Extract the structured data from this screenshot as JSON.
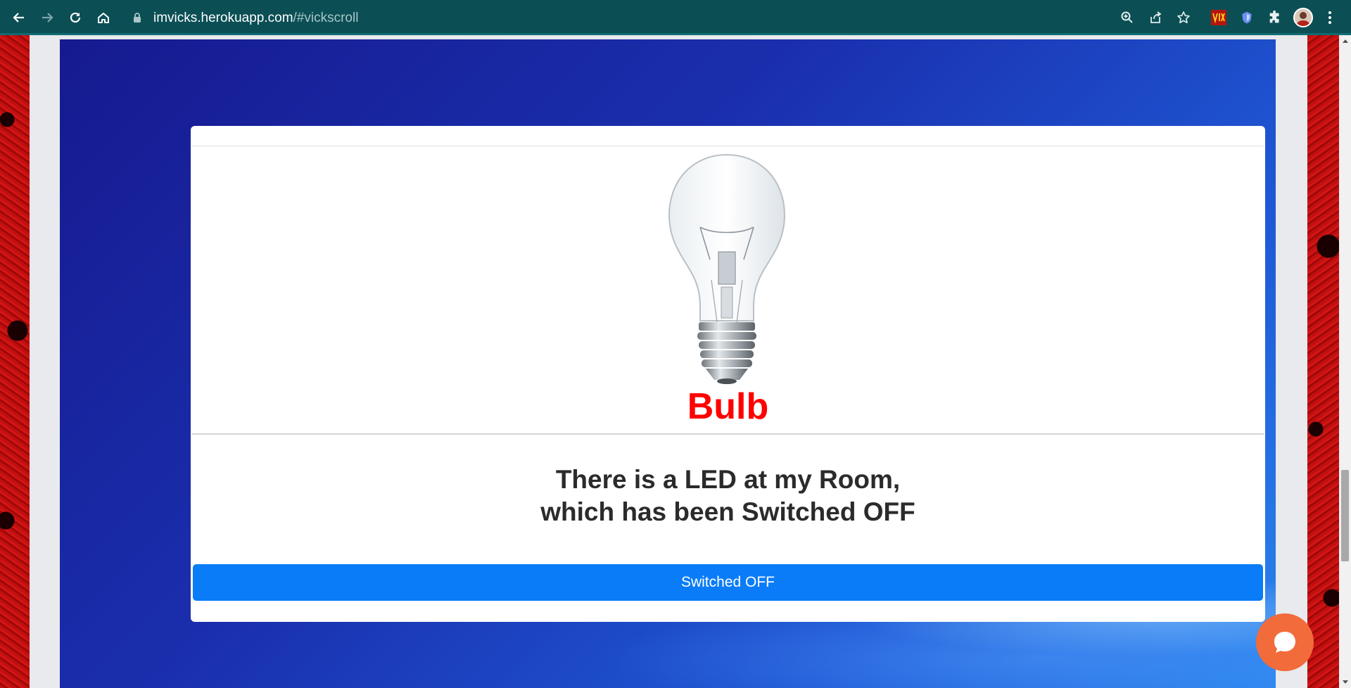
{
  "browser": {
    "url_host": "imvicks.herokuapp.com",
    "url_path": "/#vickscroll",
    "icons": {
      "back": "back-arrow-icon",
      "forward": "forward-arrow-icon",
      "reload": "reload-icon",
      "home": "home-icon",
      "lock": "lock-icon",
      "zoom": "zoom-icon",
      "share": "share-icon",
      "bookmark": "star-icon",
      "extensions": "puzzle-icon",
      "menu": "kebab-menu-icon"
    },
    "toolbar_color": "#0b4f55"
  },
  "card": {
    "title": "Bulb",
    "title_color": "#ff0000",
    "description_line1": "There is a LED at my Room,",
    "description_line2": "which has been Switched OFF",
    "button_label": "Switched OFF",
    "button_color": "#0a7cf7"
  },
  "chat_widget": {
    "icon": "chat-bubble-icon",
    "color": "#f26b3a"
  }
}
